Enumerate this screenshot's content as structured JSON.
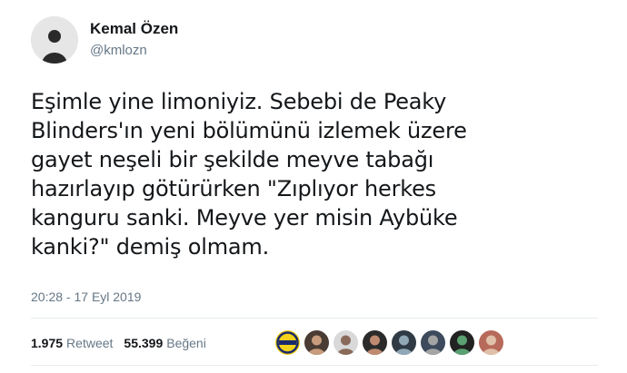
{
  "user": {
    "name": "Kemal Özen",
    "handle": "@kmlozn"
  },
  "tweet": {
    "lines": [
      "Eşimle yine limoniyiz. Sebebi de Peaky",
      "Blinders'ın yeni bölümünü izlemek üzere",
      "gayet neşeli bir şekilde meyve tabağı",
      "hazırlayıp götürürken \"Zıplıyor herkes",
      "kanguru sanki. Meyve yer misin Aybüke",
      "kanki?\" demiş olmam."
    ],
    "timestamp": "20:28 - 17 Eyl 2019"
  },
  "stats": {
    "retweets_count": "1.975",
    "retweets_label": "Retweet",
    "likes_count": "55.399",
    "likes_label": "Beğeni"
  },
  "likers": {
    "avatars": [
      {
        "icon": "team-logo-icon",
        "bg": "#f2d21b",
        "fg": "#1b2a6b"
      },
      {
        "icon": "user-photo-icon",
        "bg": "#4a3c34",
        "fg": "#c79b7c"
      },
      {
        "icon": "user-photo-icon",
        "bg": "#d9d9d9",
        "fg": "#8a6a5a"
      },
      {
        "icon": "user-photo-icon",
        "bg": "#2b2b2b",
        "fg": "#c08a72"
      },
      {
        "icon": "user-photo-icon",
        "bg": "#2f3a44",
        "fg": "#8fa7b6"
      },
      {
        "icon": "user-photo-icon",
        "bg": "#3c4a5c",
        "fg": "#a4a4a4"
      },
      {
        "icon": "user-photo-icon",
        "bg": "#222222",
        "fg": "#5aa070"
      },
      {
        "icon": "user-photo-icon",
        "bg": "#b86a5a",
        "fg": "#e0c0a8"
      }
    ]
  }
}
